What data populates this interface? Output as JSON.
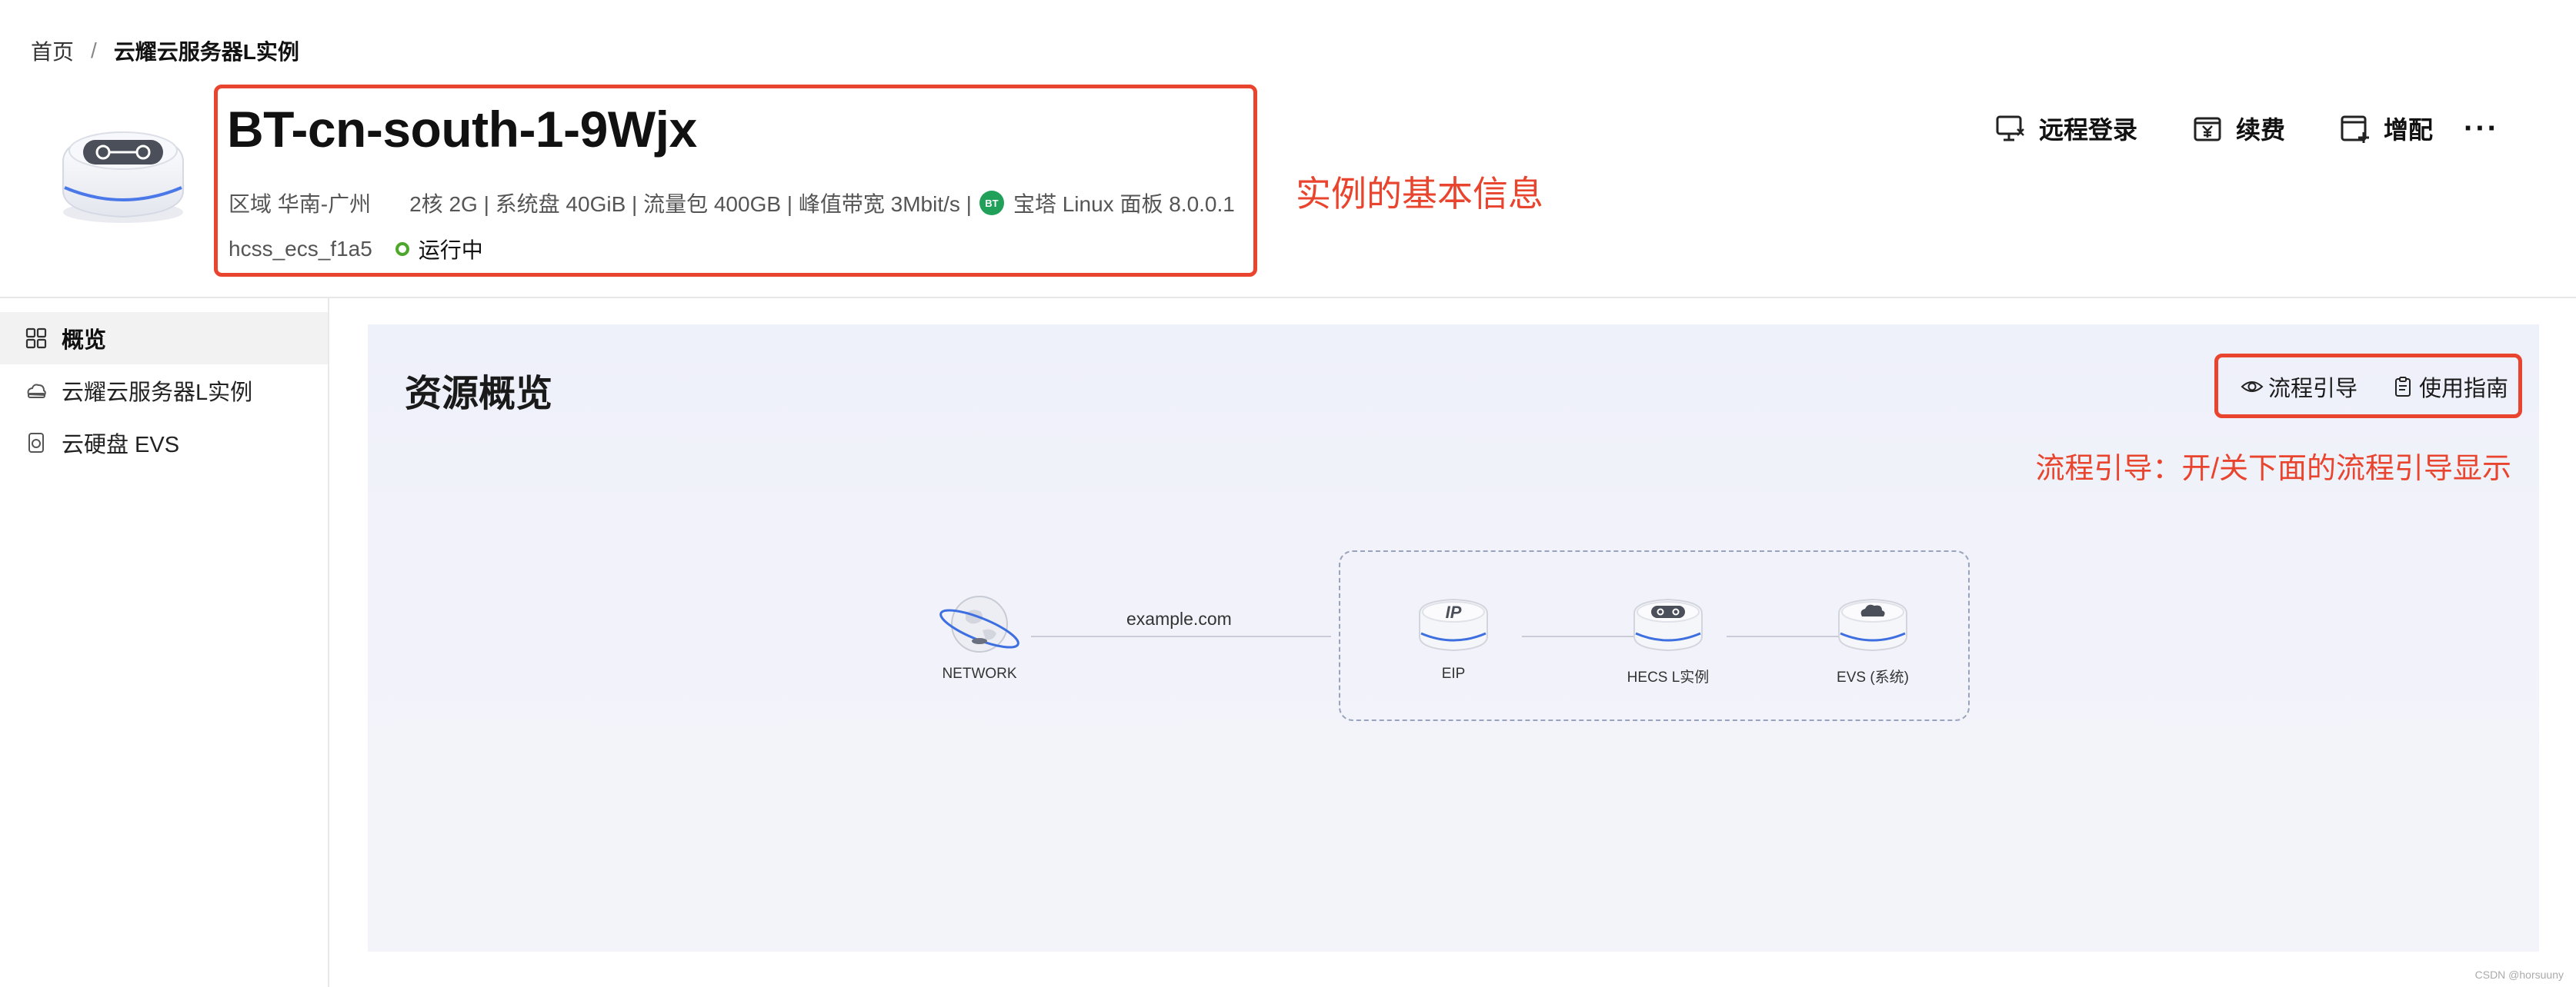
{
  "breadcrumb": {
    "home": "首页",
    "separator": "/",
    "current": "云耀云服务器L实例"
  },
  "instance": {
    "name": "BT-cn-south-1-9Wjx",
    "region": "区域 华南-广州",
    "specs": "2核  2G | 系统盘 40GiB | 流量包 400GB | 峰值带宽 3Mbit/s |",
    "image_badge": "BT",
    "image_name": "宝塔 Linux 面板 8.0.0.1",
    "id": "hcss_ecs_f1a5",
    "status": "运行中",
    "status_color": "#4ca72b"
  },
  "annotations": {
    "basic_info": "实例的基本信息",
    "flow_guide": "流程引导：开/关下面的流程引导显示"
  },
  "header_actions": [
    {
      "label": "远程登录",
      "icon": "remote-login-icon"
    },
    {
      "label": "续费",
      "icon": "renew-icon"
    },
    {
      "label": "增配",
      "icon": "upgrade-icon"
    }
  ],
  "more_label": "···",
  "sidebar": {
    "items": [
      {
        "label": "概览",
        "icon": "grid-icon",
        "active": true
      },
      {
        "label": "云耀云服务器L实例",
        "icon": "cloud-server-icon",
        "active": false
      },
      {
        "label": "云硬盘 EVS",
        "icon": "disk-icon",
        "active": false
      }
    ]
  },
  "overview": {
    "title": "资源概览",
    "flow_guide_label": "流程引导",
    "user_guide_label": "使用指南",
    "topology": {
      "link_label": "example.com",
      "nodes": [
        "NETWORK",
        "EIP",
        "HECS L实例",
        "EVS (系统)"
      ]
    }
  },
  "watermark": "CSDN @horsuuny",
  "colors": {
    "accent_red": "#e8442e",
    "panel_bg": "#eef0fa",
    "node_blue": "#3d6fe0"
  }
}
